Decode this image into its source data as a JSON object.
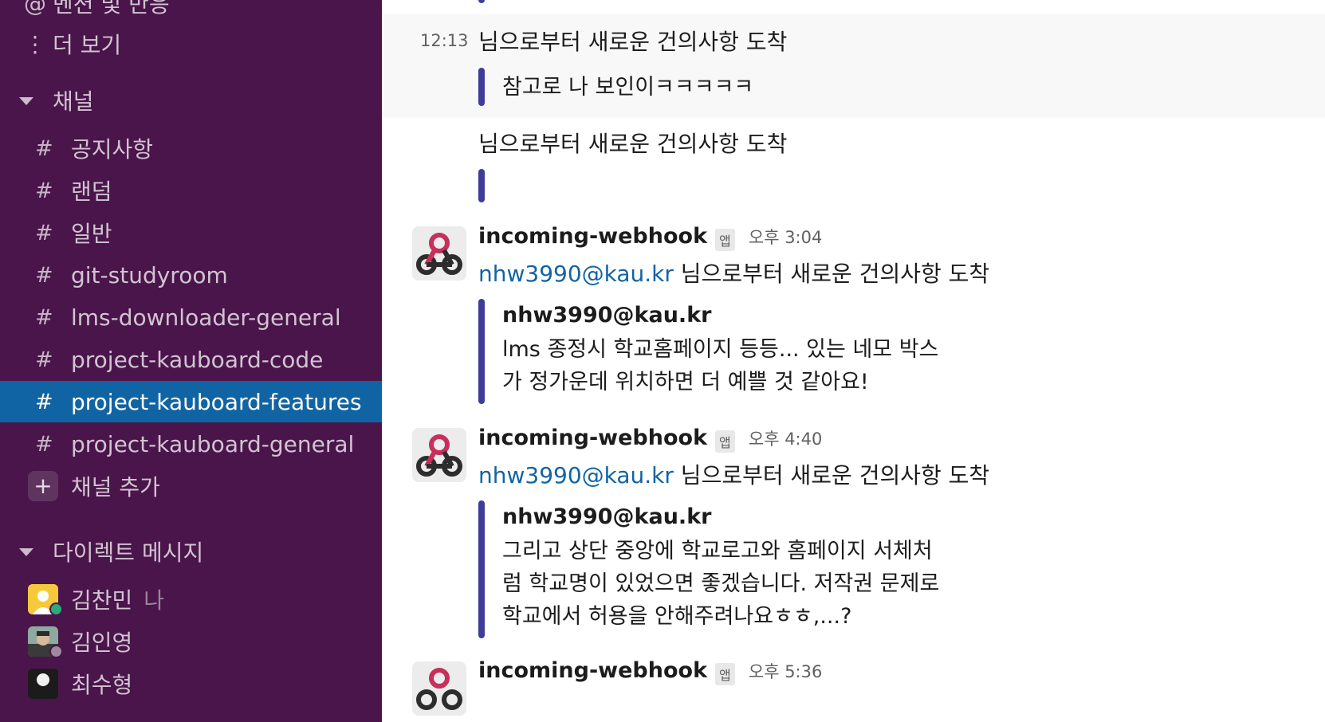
{
  "sidebar": {
    "top_partial": "멘션 및 반응",
    "more": "더 보기",
    "channels_header": "채널",
    "channels": [
      {
        "name": "공지사항"
      },
      {
        "name": "랜덤"
      },
      {
        "name": "일반"
      },
      {
        "name": "git-studyroom"
      },
      {
        "name": "lms-downloader-general"
      },
      {
        "name": "project-kauboard-code"
      },
      {
        "name": "project-kauboard-features",
        "active": true
      },
      {
        "name": "project-kauboard-general"
      }
    ],
    "add_channel": "채널 추가",
    "dm_header": "다이렉트 메시지",
    "dms": [
      {
        "name": "김찬민",
        "tag": "나"
      },
      {
        "name": "김인영"
      },
      {
        "name": "최수형"
      }
    ]
  },
  "messages": {
    "m1": {
      "time": "12:13",
      "text": "님으로부터 새로운 건의사항 도착",
      "quote": "참고로 나 보인이ㅋㅋㅋㅋㅋ"
    },
    "m2": {
      "text": "님으로부터 새로운 건의사항 도착"
    },
    "m3": {
      "sender": "incoming-webhook",
      "badge": "앱",
      "time": "오후 3:04",
      "link": "nhw3990@kau.kr",
      "text": " 님으로부터 새로운 건의사항 도착",
      "quote_title": "nhw3990@kau.kr",
      "quote_body": "lms 종정시 학교홈페이지 등등... 있는 네모 박스가 정가운데 위치하면 더 예쁠 것 같아요!"
    },
    "m4": {
      "sender": "incoming-webhook",
      "badge": "앱",
      "time": "오후 4:40",
      "link": "nhw3990@kau.kr",
      "text": " 님으로부터 새로운 건의사항 도착",
      "quote_title": "nhw3990@kau.kr",
      "quote_body": "그리고 상단 중앙에 학교로고와 홈페이지 서체처럼 학교명이 있었으면 좋겠습니다. 저작권 문제로 학교에서 허용을 안해주려나요ㅎㅎ,...?"
    },
    "m5": {
      "sender": "incoming-webhook",
      "badge": "앱",
      "time": "오후 5:36"
    }
  },
  "colors": {
    "sidebar_bg": "#4a154b",
    "active_channel": "#1164a3",
    "quote_bar": "#3d3d99",
    "link": "#1264a3"
  }
}
